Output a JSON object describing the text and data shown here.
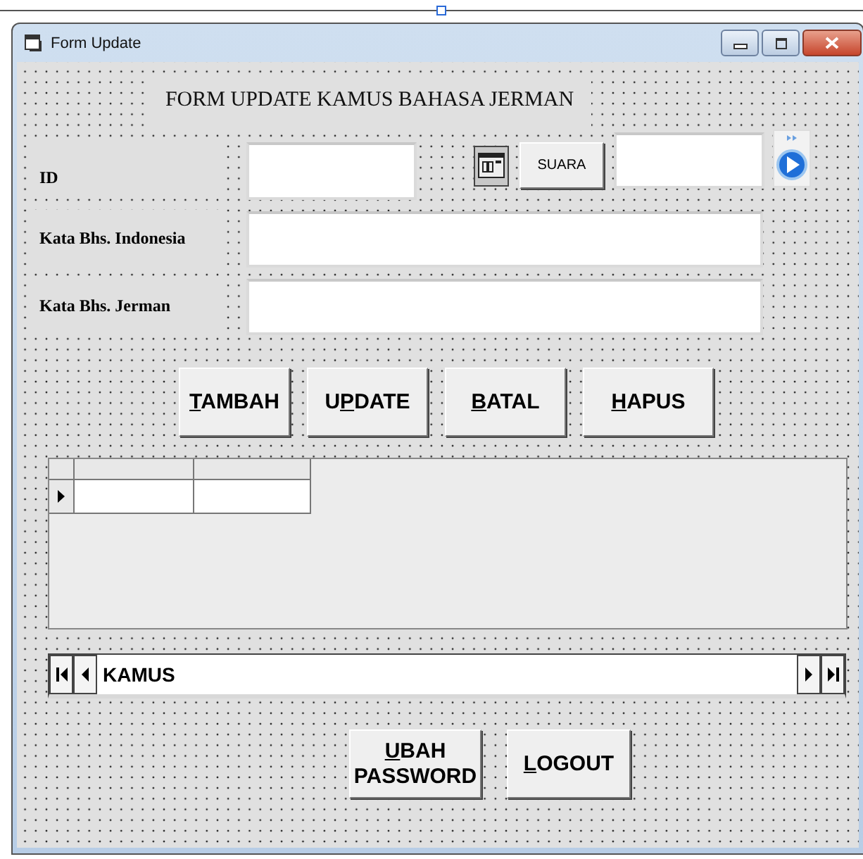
{
  "window": {
    "title": "Form Update"
  },
  "heading": "FORM UPDATE KAMUS BAHASA JERMAN",
  "fields": [
    {
      "label": "ID"
    },
    {
      "label": "Kata Bhs. Indonesia"
    },
    {
      "label": "Kata Bhs. Jerman"
    }
  ],
  "sound_button": "SUARA",
  "buttons": [
    {
      "access_key": "T",
      "rest": "AMBAH"
    },
    {
      "lead": "U",
      "access_key": "P",
      "rest": "DATE"
    },
    {
      "access_key": "B",
      "rest": "ATAL"
    },
    {
      "access_key": "H",
      "rest": "APUS"
    }
  ],
  "data_control": {
    "caption": "KAMUS"
  },
  "bottom_buttons": [
    {
      "access_key": "U",
      "rest": "BAH PASSWORD"
    },
    {
      "access_key": "L",
      "rest": "OGOUT"
    }
  ]
}
